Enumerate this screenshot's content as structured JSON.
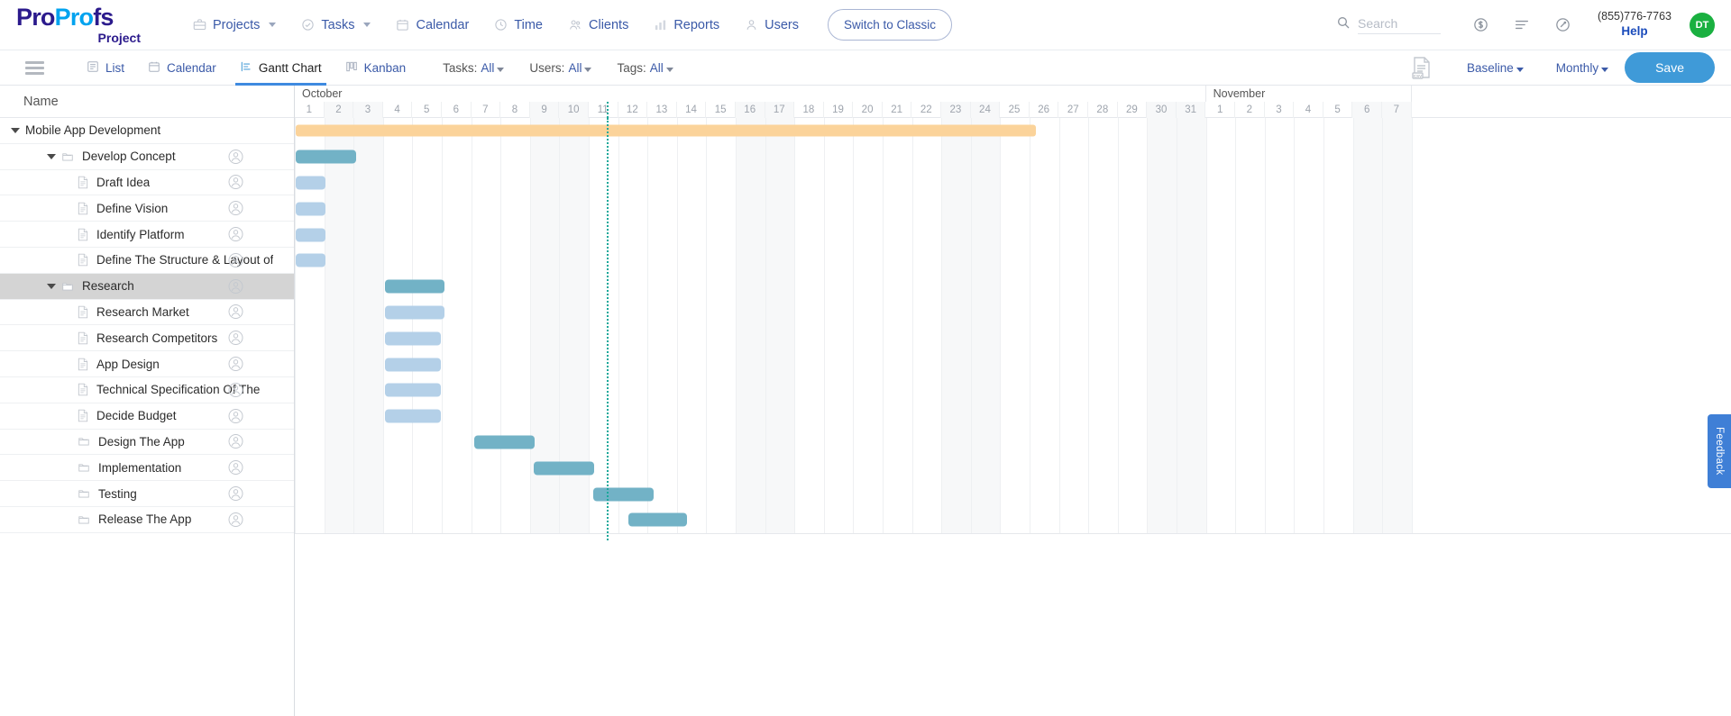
{
  "brand": {
    "name_part1": "Pro",
    "name_part2": "Profs",
    "subtitle": "Project"
  },
  "header": {
    "nav": [
      {
        "label": "Projects",
        "icon": "briefcase-icon",
        "caret": true
      },
      {
        "label": "Tasks",
        "icon": "check-circle-icon",
        "caret": true
      },
      {
        "label": "Calendar",
        "icon": "calendar-icon",
        "caret": false
      },
      {
        "label": "Time",
        "icon": "clock-icon",
        "caret": false
      },
      {
        "label": "Clients",
        "icon": "clients-icon",
        "caret": false
      },
      {
        "label": "Reports",
        "icon": "bar-chart-icon",
        "caret": false
      },
      {
        "label": "Users",
        "icon": "user-icon",
        "caret": false
      }
    ],
    "switch_classic": "Switch to Classic",
    "search_placeholder": "Search",
    "phone": "(855)776-7763",
    "help": "Help",
    "avatar_initials": "DT",
    "avatar_color": "#1ab040"
  },
  "toolbar": {
    "views": [
      {
        "label": "List",
        "icon": "list-icon",
        "active": false
      },
      {
        "label": "Calendar",
        "icon": "calendar-icon",
        "active": false
      },
      {
        "label": "Gantt Chart",
        "icon": "gantt-icon",
        "active": true
      },
      {
        "label": "Kanban",
        "icon": "kanban-icon",
        "active": false
      }
    ],
    "filters": [
      {
        "label": "Tasks:",
        "value": "All"
      },
      {
        "label": "Users:",
        "value": "All"
      },
      {
        "label": "Tags:",
        "value": "All"
      }
    ],
    "export_icon": "csv-export-icon",
    "baseline": "Baseline",
    "zoom_level": "Monthly",
    "save_label": "Save",
    "accent_color": "#3f9ad8"
  },
  "tasklist": {
    "column_header": "Name",
    "rows": [
      {
        "name": "Mobile App Development",
        "level": 0,
        "type": "project",
        "triangle": true,
        "icon": null,
        "avatar": false,
        "selected": false
      },
      {
        "name": "Develop Concept",
        "level": 1,
        "type": "group",
        "triangle": true,
        "icon": "folder-icon",
        "avatar": true,
        "selected": false
      },
      {
        "name": "Draft Idea",
        "level": 2,
        "type": "task",
        "triangle": false,
        "icon": "file-icon",
        "avatar": true,
        "selected": false
      },
      {
        "name": "Define Vision",
        "level": 2,
        "type": "task",
        "triangle": false,
        "icon": "file-icon",
        "avatar": true,
        "selected": false
      },
      {
        "name": "Identify Platform",
        "level": 2,
        "type": "task",
        "triangle": false,
        "icon": "file-icon",
        "avatar": true,
        "selected": false
      },
      {
        "name": "Define The Structure & Layout of",
        "level": 2,
        "type": "task",
        "triangle": false,
        "icon": "file-icon",
        "avatar": true,
        "selected": false
      },
      {
        "name": "Research",
        "level": 1,
        "type": "group",
        "triangle": true,
        "icon": "folder-icon",
        "avatar": true,
        "selected": true
      },
      {
        "name": "Research Market",
        "level": 2,
        "type": "task",
        "triangle": false,
        "icon": "file-icon",
        "avatar": true,
        "selected": false
      },
      {
        "name": "Research Competitors",
        "level": 2,
        "type": "task",
        "triangle": false,
        "icon": "file-icon",
        "avatar": true,
        "selected": false
      },
      {
        "name": "App Design",
        "level": 2,
        "type": "task",
        "triangle": false,
        "icon": "file-icon",
        "avatar": true,
        "selected": false
      },
      {
        "name": "Technical Specification Of The",
        "level": 2,
        "type": "task",
        "triangle": false,
        "icon": "file-icon",
        "avatar": true,
        "selected": false
      },
      {
        "name": "Decide Budget",
        "level": 2,
        "type": "task",
        "triangle": false,
        "icon": "file-icon",
        "avatar": true,
        "selected": false
      },
      {
        "name": "Design The App",
        "level": 2,
        "type": "group",
        "triangle": false,
        "icon": "folder-icon",
        "avatar": true,
        "selected": false
      },
      {
        "name": "Implementation",
        "level": 2,
        "type": "group",
        "triangle": false,
        "icon": "folder-icon",
        "avatar": true,
        "selected": false
      },
      {
        "name": "Testing",
        "level": 2,
        "type": "group",
        "triangle": false,
        "icon": "folder-icon",
        "avatar": true,
        "selected": false
      },
      {
        "name": "Release The App",
        "level": 2,
        "type": "group",
        "triangle": false,
        "icon": "folder-icon",
        "avatar": true,
        "selected": false
      }
    ]
  },
  "gantt": {
    "months": [
      {
        "label": "October",
        "days": 31
      },
      {
        "label": "November",
        "days": 7
      }
    ],
    "day_labels": [
      1,
      2,
      3,
      4,
      5,
      6,
      7,
      8,
      9,
      10,
      11,
      12,
      13,
      14,
      15,
      16,
      17,
      18,
      19,
      20,
      21,
      22,
      23,
      24,
      25,
      26,
      27,
      28,
      29,
      30,
      31,
      1,
      2,
      3,
      4,
      5,
      6,
      7
    ],
    "weekend_indices": [
      1,
      2,
      8,
      9,
      15,
      16,
      22,
      23,
      29,
      30,
      36,
      37
    ],
    "today_index": 10.6,
    "colors": {
      "project_bar": "#fbd39a",
      "group_bar": "#72b2c6",
      "task_bar": "#b4d0e8",
      "today_line": "#1aa89a"
    },
    "bars": [
      {
        "row": 0,
        "start": 0.03,
        "span": 25.2,
        "type": "project"
      },
      {
        "row": 1,
        "start": 0.03,
        "span": 2.05,
        "type": "group"
      },
      {
        "row": 2,
        "start": 0.03,
        "span": 1.02,
        "type": "task"
      },
      {
        "row": 3,
        "start": 0.03,
        "span": 1.02,
        "type": "task"
      },
      {
        "row": 4,
        "start": 0.03,
        "span": 1.02,
        "type": "task"
      },
      {
        "row": 5,
        "start": 0.03,
        "span": 1.02,
        "type": "task"
      },
      {
        "row": 6,
        "start": 3.08,
        "span": 2.02,
        "type": "group"
      },
      {
        "row": 7,
        "start": 3.08,
        "span": 2.02,
        "type": "task"
      },
      {
        "row": 8,
        "start": 3.08,
        "span": 1.9,
        "type": "task"
      },
      {
        "row": 9,
        "start": 3.08,
        "span": 1.9,
        "type": "task"
      },
      {
        "row": 10,
        "start": 3.08,
        "span": 1.9,
        "type": "task"
      },
      {
        "row": 11,
        "start": 3.08,
        "span": 1.9,
        "type": "task"
      },
      {
        "row": 12,
        "start": 6.1,
        "span": 2.05,
        "type": "group"
      },
      {
        "row": 13,
        "start": 8.12,
        "span": 2.05,
        "type": "group"
      },
      {
        "row": 14,
        "start": 10.15,
        "span": 2.05,
        "type": "group"
      },
      {
        "row": 15,
        "start": 11.35,
        "span": 2.0,
        "type": "group"
      }
    ]
  },
  "feedback": {
    "label": "Feedback"
  }
}
